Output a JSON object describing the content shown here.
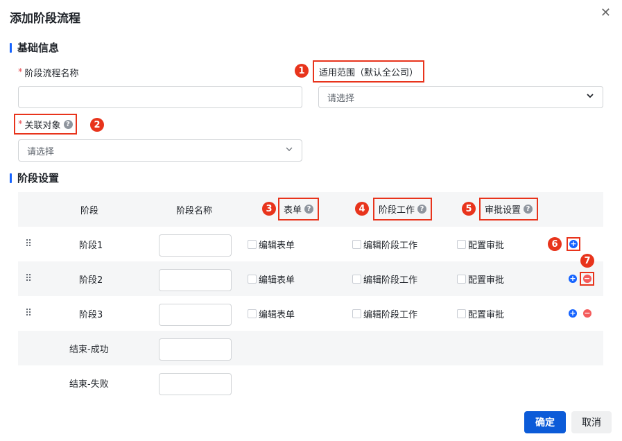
{
  "dialog": {
    "title": "添加阶段流程",
    "close": "✕"
  },
  "basic": {
    "section_title": "基础信息",
    "name_label": "阶段流程名称",
    "required_mark": "*",
    "scope_label": "适用范围（默认全公司）",
    "scope_placeholder": "请选择",
    "related_label": "关联对象",
    "related_placeholder": "请选择"
  },
  "stage": {
    "section_title": "阶段设置",
    "headers": [
      "阶段",
      "阶段名称",
      "表单",
      "阶段工作",
      "审批设置"
    ],
    "rows": [
      {
        "stage": "阶段1",
        "form": "编辑表单",
        "work": "编辑阶段工作",
        "approval": "配置审批"
      },
      {
        "stage": "阶段2",
        "form": "编辑表单",
        "work": "编辑阶段工作",
        "approval": "配置审批"
      },
      {
        "stage": "阶段3",
        "form": "编辑表单",
        "work": "编辑阶段工作",
        "approval": "配置审批"
      }
    ],
    "end_rows": [
      "结束-成功",
      "结束-失败"
    ]
  },
  "badges": [
    "1",
    "2",
    "3",
    "4",
    "5",
    "6",
    "7"
  ],
  "icons": {
    "help": "?",
    "plus": "+",
    "minus": "−",
    "drag": "⠿",
    "chevron": "⌄"
  },
  "footer": {
    "ok": "确定",
    "cancel": "取消"
  },
  "colors": {
    "primary": "#0c5bd8",
    "annotation_red": "#e8341c",
    "danger": "#f45b5b"
  }
}
